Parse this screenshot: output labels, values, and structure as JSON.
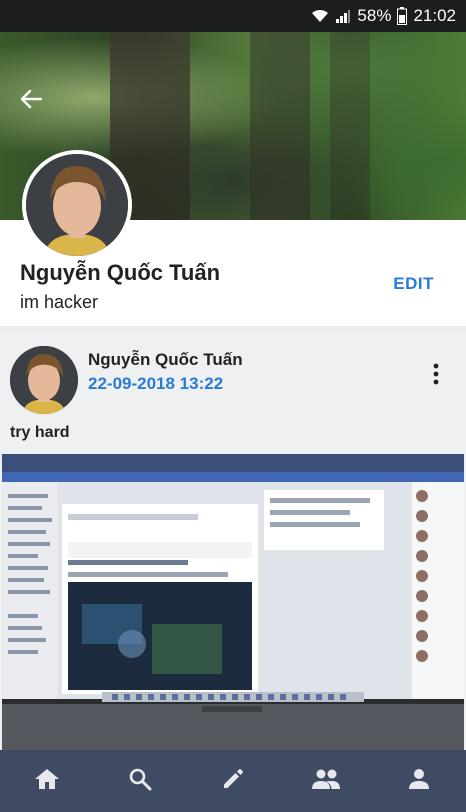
{
  "status_bar": {
    "battery_percent": "58%",
    "time": "21:02",
    "icons": [
      "wifi-icon",
      "signal-icon",
      "battery-icon"
    ]
  },
  "header": {
    "back_icon": "arrow-left-icon"
  },
  "profile": {
    "name": "Nguyễn Quốc Tuấn",
    "bio": "im hacker",
    "edit_label": "EDIT"
  },
  "post": {
    "author": "Nguyễn Quốc Tuấn",
    "timestamp": "22-09-2018 13:22",
    "text": "try hard",
    "more_icon": "more-vertical-icon"
  },
  "bottom_nav": {
    "items": [
      {
        "icon": "home-icon"
      },
      {
        "icon": "search-icon"
      },
      {
        "icon": "edit-pencil-icon"
      },
      {
        "icon": "people-icon"
      },
      {
        "icon": "person-icon"
      }
    ]
  },
  "colors": {
    "accent": "#2b7bd6",
    "nav_bg": "#3f4a63",
    "nav_icon": "#e6e8ec",
    "status_bg": "#1b1d1f"
  }
}
